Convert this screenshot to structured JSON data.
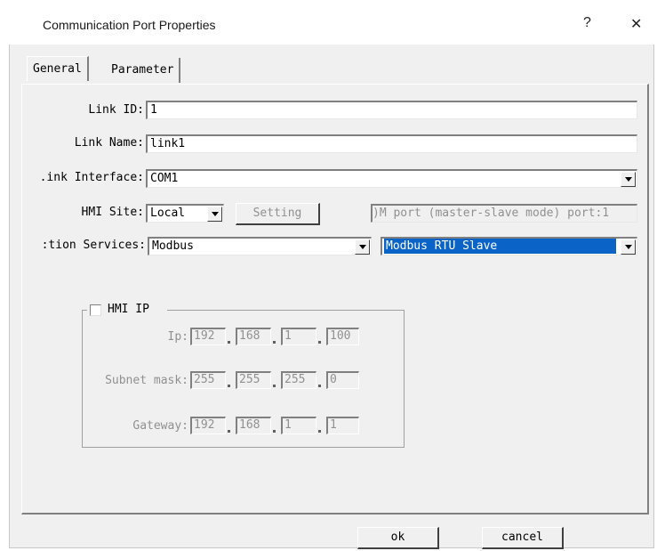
{
  "window": {
    "title": "Communication Port Properties",
    "help": "?",
    "close": "✕"
  },
  "tabs": [
    {
      "label": "General"
    },
    {
      "label": "Parameter"
    }
  ],
  "general": {
    "link_id": {
      "label": "Link ID:",
      "value": "1"
    },
    "link_name": {
      "label": "Link Name:",
      "value": "link1"
    },
    "link_interface": {
      "label": ".ink Interface:",
      "value": "COM1"
    },
    "hmi_site": {
      "label": "HMI Site:",
      "value": "Local",
      "setting_button": "Setting",
      "port_info": ")M port (master-slave mode) port:1"
    },
    "services": {
      "label": ":tion Services:",
      "protocol": "Modbus",
      "mode": "Modbus RTU Slave"
    }
  },
  "hmi_ip": {
    "checkbox_label": "HMI IP",
    "checked": false,
    "ip": {
      "label": "Ip:",
      "octets": [
        "192",
        "168",
        "1",
        "100"
      ]
    },
    "subnet_mask": {
      "label": "Subnet mask:",
      "octets": [
        "255",
        "255",
        "255",
        "0"
      ]
    },
    "gateway": {
      "label": "Gateway:",
      "octets": [
        "192",
        "168",
        "1",
        "1"
      ]
    }
  },
  "buttons": {
    "ok": "ok",
    "cancel": "cancel"
  },
  "colors": {
    "selected_bg": "#0a64c8",
    "dialog_bg": "#f0f0f0",
    "disabled_text": "#909090"
  }
}
